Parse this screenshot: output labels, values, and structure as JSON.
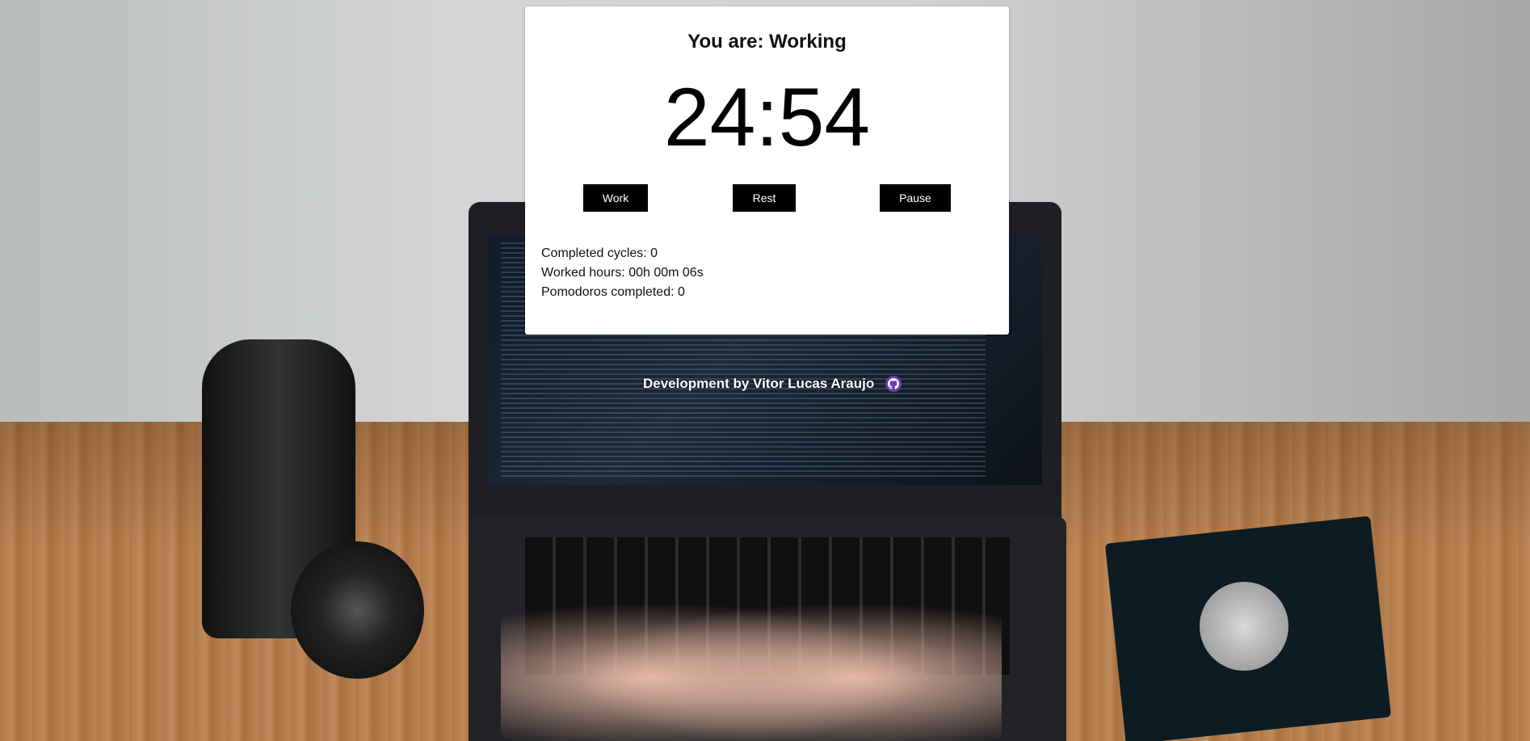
{
  "status_label": "You are: Working",
  "timer": "24:54",
  "buttons": {
    "work": "Work",
    "rest": "Rest",
    "pause": "Pause"
  },
  "stats": {
    "completed_cycles": "Completed cycles: 0",
    "worked_hours": "Worked hours: 00h 00m 06s",
    "pomodoros_completed": "Pomodoros completed: 0"
  },
  "footer": {
    "credit": "Development by Vitor Lucas Araujo",
    "icon": "github-icon"
  }
}
